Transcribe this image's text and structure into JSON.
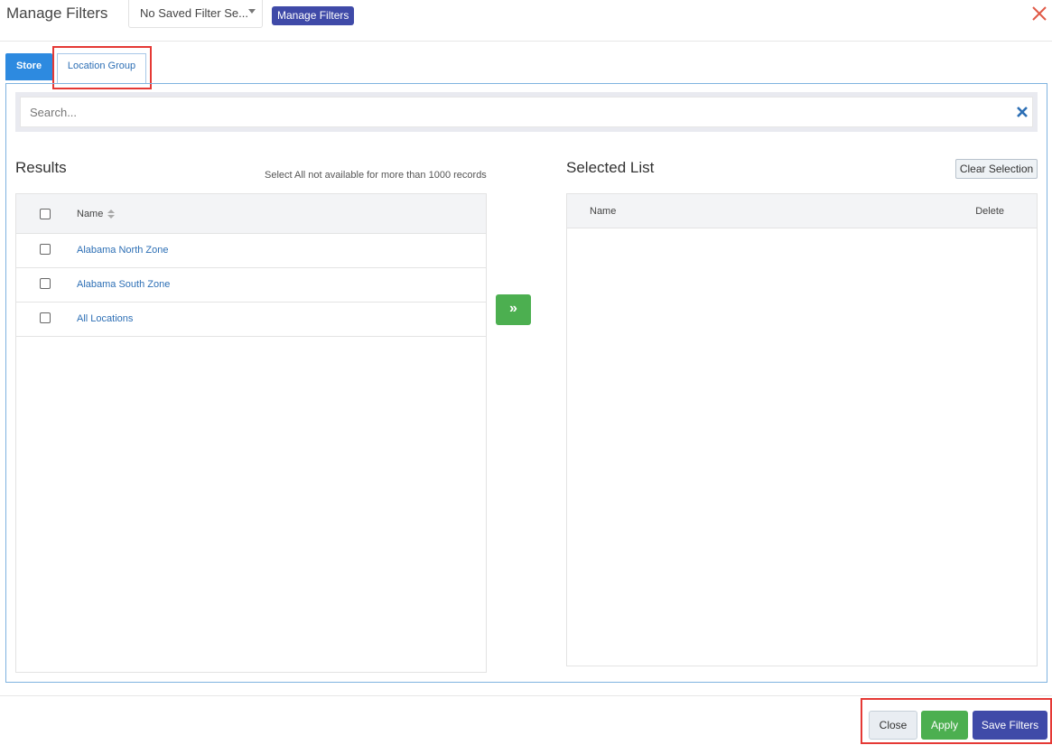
{
  "header": {
    "title": "Manage Filters",
    "saved_filter_value": "No Saved Filter Se...",
    "manage_button_label": "Manage Filters"
  },
  "tabs": [
    {
      "label": "Store",
      "active": false
    },
    {
      "label": "Location Group",
      "active": true
    }
  ],
  "search": {
    "placeholder": "Search...",
    "value": ""
  },
  "results": {
    "title": "Results",
    "note": "Select All not available for more than 1000 records",
    "column_name": "Name",
    "rows": [
      {
        "name": "Alabama North Zone",
        "checked": false
      },
      {
        "name": "Alabama South Zone",
        "checked": false
      },
      {
        "name": "All Locations",
        "checked": false
      }
    ]
  },
  "move_button_glyph": "»",
  "selected": {
    "title": "Selected List",
    "clear_label": "Clear Selection",
    "column_name": "Name",
    "column_delete": "Delete",
    "rows": []
  },
  "footer": {
    "close_label": "Close",
    "apply_label": "Apply",
    "save_label": "Save Filters"
  },
  "colors": {
    "primary_blue": "#2d8ae0",
    "indigo": "#3f4aa8",
    "green": "#4caf50",
    "highlight_red": "#e53935",
    "close_icon_red": "#e05a47"
  }
}
